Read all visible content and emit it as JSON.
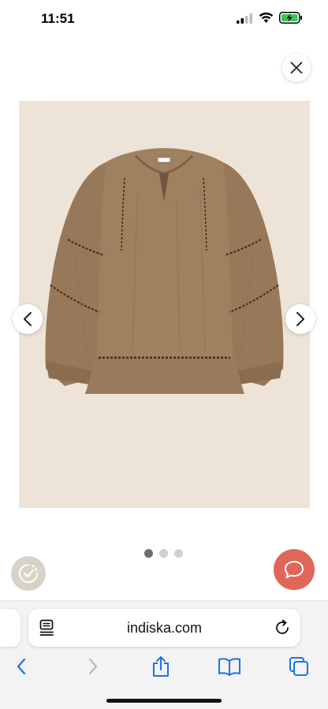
{
  "status_bar": {
    "time": "11:51",
    "icons": [
      "cellular-signal-icon",
      "wifi-icon",
      "battery-charging-icon"
    ]
  },
  "viewer": {
    "close_icon": "close-icon",
    "prev_icon": "chevron-left-icon",
    "next_icon": "chevron-right-icon",
    "image_subject": "brown-blouse-product-photo",
    "pagination": {
      "total": 3,
      "current": 1
    }
  },
  "widgets": {
    "badge_icon": "seal-badge-icon",
    "chat_icon": "chat-bubble-icon",
    "chat_color": "#e0665a"
  },
  "browser": {
    "url": "indiska.com",
    "reader_icon": "page-menu-icon",
    "reload_icon": "reload-icon",
    "toolbar": [
      "back-icon",
      "forward-icon",
      "share-icon",
      "bookmarks-icon",
      "tabs-icon"
    ],
    "accent": "#1a73e8"
  },
  "colors": {
    "image_background": "#ede3d7",
    "garment": "#9a7b5e"
  }
}
